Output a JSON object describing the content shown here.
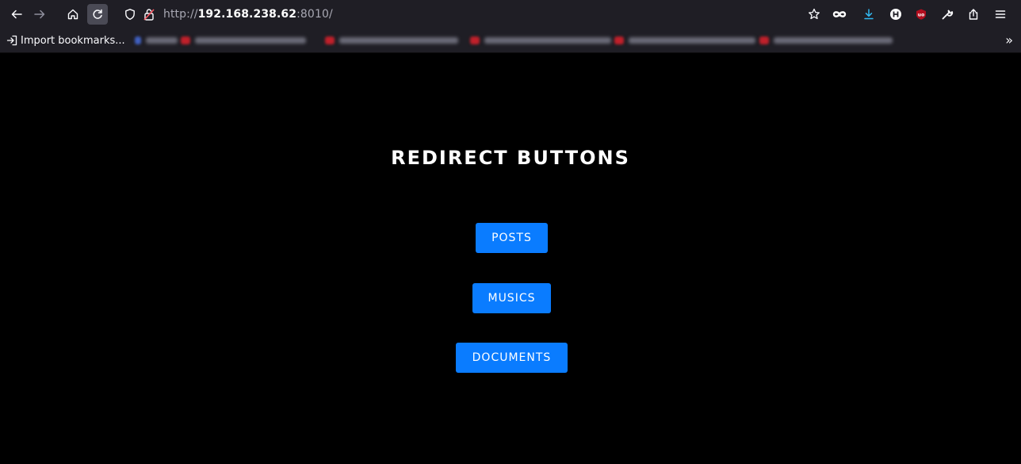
{
  "browser": {
    "url_protocol": "http://",
    "url_host": "192.168.238.62",
    "url_port_path": ":8010/",
    "bookmarks_import_label": "Import bookmarks...",
    "bookmarks_overflow_label": "»"
  },
  "page": {
    "title": "REDIRECT BUTTONS",
    "buttons": [
      {
        "label": "POSTS"
      },
      {
        "label": "MUSICS"
      },
      {
        "label": "DOCUMENTS"
      }
    ]
  },
  "colors": {
    "background": "#000000",
    "button": "#0a7cff",
    "toolbar": "#1f1e25"
  },
  "icons": {
    "nav": [
      "back-arrow-icon",
      "forward-arrow-icon",
      "home-icon",
      "reload-icon"
    ],
    "url": [
      "tracking-shield-icon",
      "insecure-lock-icon"
    ],
    "toolbar": [
      "bookmark-star-icon",
      "infinity-extension-icon",
      "download-icon",
      "h-extension-icon",
      "ublock-icon",
      "wrench-icon",
      "share-icon",
      "hamburger-menu-icon"
    ]
  }
}
